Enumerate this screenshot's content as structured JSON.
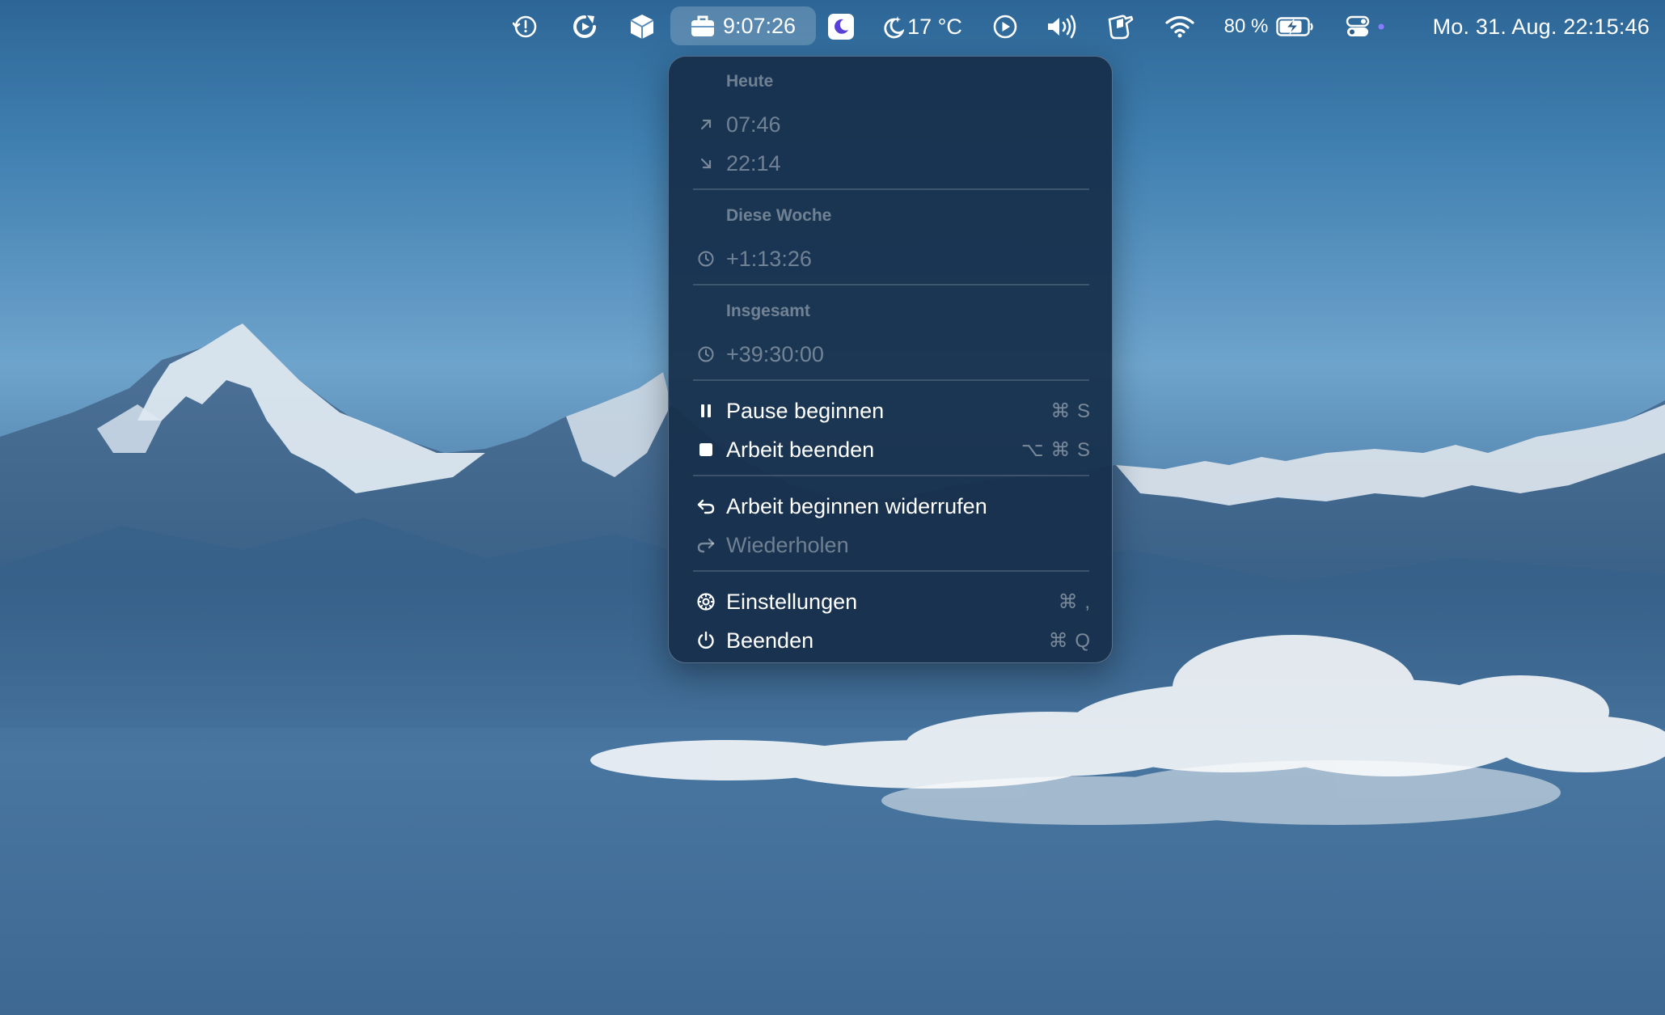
{
  "menubar": {
    "icons": [
      "time-machine-icon",
      "refresh-icon",
      "box-app-icon",
      "briefcase-icon",
      "moon-icon",
      "weather-moon-icon",
      "play-circle-icon",
      "volume-icon",
      "hand-icon",
      "wifi-icon",
      "battery-charging-icon",
      "control-center-icon"
    ],
    "timer": "9:07:26",
    "temperature": "17 °C",
    "battery_percent": "80 %",
    "datetime": "Mo. 31. Aug.  22:15:46",
    "accent_color": "#8a7bff"
  },
  "dropdown": {
    "today": {
      "header": "Heute",
      "start": "07:46",
      "end": "22:14"
    },
    "week": {
      "header": "Diese Woche",
      "value": "+1:13:26"
    },
    "total": {
      "header": "Insgesamt",
      "value": "+39:30:00"
    },
    "actions": {
      "pause": {
        "label": "Pause beginnen",
        "shortcut": "⌘ S"
      },
      "stop": {
        "label": "Arbeit beenden",
        "shortcut": "⌥ ⌘ S"
      }
    },
    "history": {
      "undo": {
        "label": "Arbeit beginnen widerrufen"
      },
      "redo": {
        "label": "Wiederholen"
      }
    },
    "app": {
      "settings": {
        "label": "Einstellungen",
        "shortcut": "⌘ ,"
      },
      "quit": {
        "label": "Beenden",
        "shortcut": "⌘ Q"
      }
    }
  }
}
